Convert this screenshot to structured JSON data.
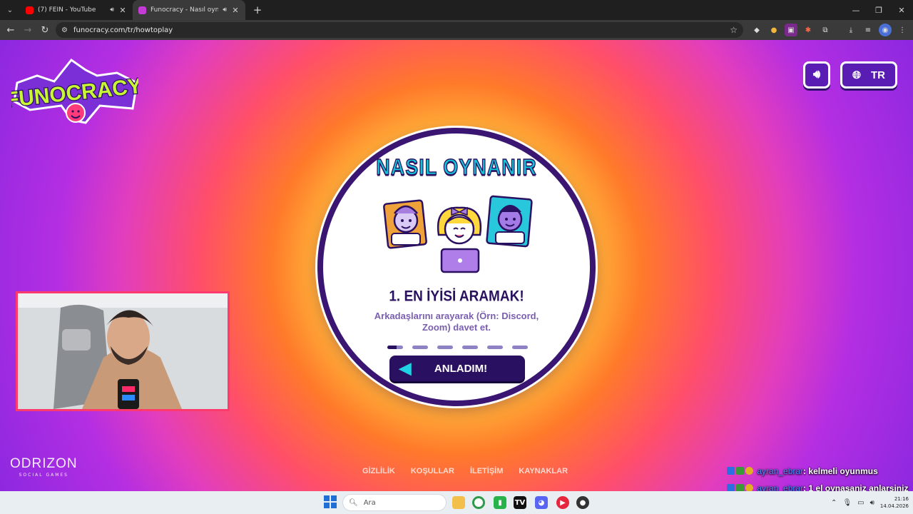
{
  "browser": {
    "tabs": [
      {
        "title": "(7) FEIN - YouTube",
        "active": false,
        "favicon_color": "#ff0000"
      },
      {
        "title": "Funocracy - Nasıl oynanır",
        "active": true,
        "favicon_color": "#c43bd6"
      }
    ],
    "url": "funocracy.com/tr/howtoplay"
  },
  "page": {
    "logo_text": "FUNOCRACY",
    "language_label": "TR",
    "howto": {
      "title": "NASIL OYNANIR",
      "step_title": "1. EN İYİSİ ARAMAK!",
      "step_desc": "Arkadaşlarını arayarak (Örn: Discord, Zoom) davet et.",
      "total_steps": 6,
      "current_step": 1,
      "button_label": "ANLADIM!"
    },
    "footer_links": [
      "GİZLİLİK",
      "KOŞULLAR",
      "İLETİŞİM",
      "KAYNAKLAR"
    ],
    "brand": {
      "name": "ODRIZON",
      "sub": "SOCIAL GAMES"
    }
  },
  "chat": [
    {
      "user": "ayran_ebrar",
      "message": ": kelmeli oyunmus"
    },
    {
      "user": "ayran_ebrar",
      "message": ": 1 el oynasaniz anlarsiniz"
    }
  ],
  "taskbar": {
    "search_placeholder": "Ara",
    "time": "21:16",
    "date": "14.04.2026"
  },
  "colors": {
    "accent_dark": "#2a1060",
    "title_cyan": "#14c1d6",
    "webcam_border": "#ff3b6e"
  }
}
